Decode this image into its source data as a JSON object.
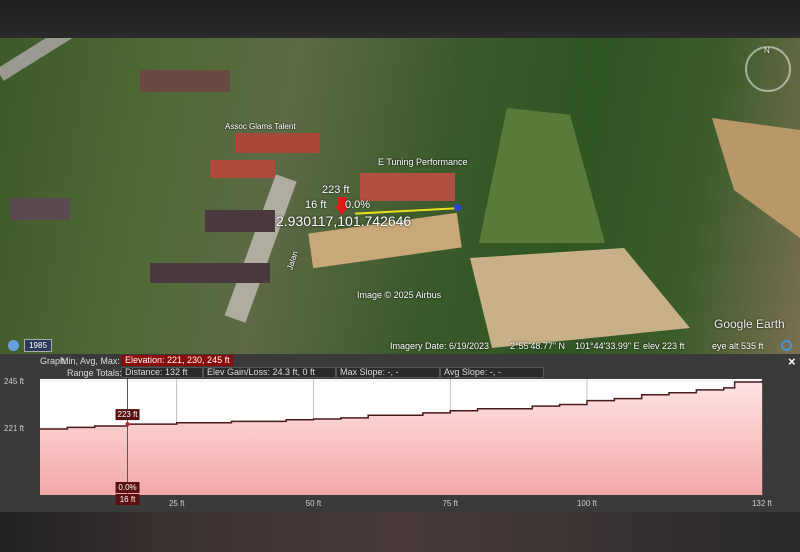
{
  "map": {
    "labels": {
      "place1": "Assoc Glams Talent",
      "place2": "E Tuning Performance",
      "road": "Jalan",
      "elev_marker": "223 ft",
      "distance_marker": "16 ft",
      "slope_marker": "0.0%",
      "coordinates": "2.930117,101.742646",
      "copyright": "Image © 2025 Airbus",
      "logo": "Google Earth",
      "compass": "N"
    },
    "status": {
      "year": "1985",
      "imagery_date": "Imagery Date: 6/19/2023",
      "lat": "2°55'48.77\" N",
      "lon": "101°44'33.99\" E",
      "elev": "elev  223 ft",
      "eye_alt": "eye alt   535 ft"
    }
  },
  "profile": {
    "graph_label": "Graph:",
    "min_avg_max_label": "Min, Avg, Max:",
    "elevation": "Elevation: 221, 230, 245 ft",
    "range_totals_label": "Range Totals:",
    "distance": "Distance: 132 ft",
    "gain_loss": "Elev Gain/Loss: 24.3 ft, 0 ft",
    "max_slope": "Max Slope: -, -",
    "avg_slope": "Avg Slope: -, -",
    "close": "×"
  },
  "chart_data": {
    "type": "area",
    "xlim": [
      0,
      132
    ],
    "y_ticks": [
      "245 ft",
      "221 ft"
    ],
    "x_ticks": [
      "25 ft",
      "50 ft",
      "75 ft",
      "100 ft",
      "132 ft"
    ],
    "x_tick_values": [
      25,
      50,
      75,
      100,
      132
    ],
    "y_tick_values": [
      245,
      221
    ],
    "cursor": {
      "x": 16,
      "x_label": "16 ft",
      "y_label": "223 ft",
      "slope_label": "0.0%"
    },
    "x": [
      0,
      5,
      10,
      16,
      25,
      35,
      45,
      50,
      55,
      60,
      70,
      75,
      80,
      90,
      95,
      100,
      105,
      110,
      115,
      120,
      125,
      127,
      132
    ],
    "y": [
      220.5,
      221.3,
      222,
      223,
      223.7,
      224.4,
      225.2,
      225.6,
      226.2,
      227.5,
      228.7,
      229.8,
      230.8,
      232.2,
      233,
      235,
      236,
      238,
      239,
      240.5,
      241.5,
      244.5,
      245
    ],
    "colors": {
      "line": "#4a1a1a",
      "fill_top": "#ffe4e4",
      "fill_bottom": "#f4a8a8",
      "cursor_label": "#5a1010"
    }
  }
}
